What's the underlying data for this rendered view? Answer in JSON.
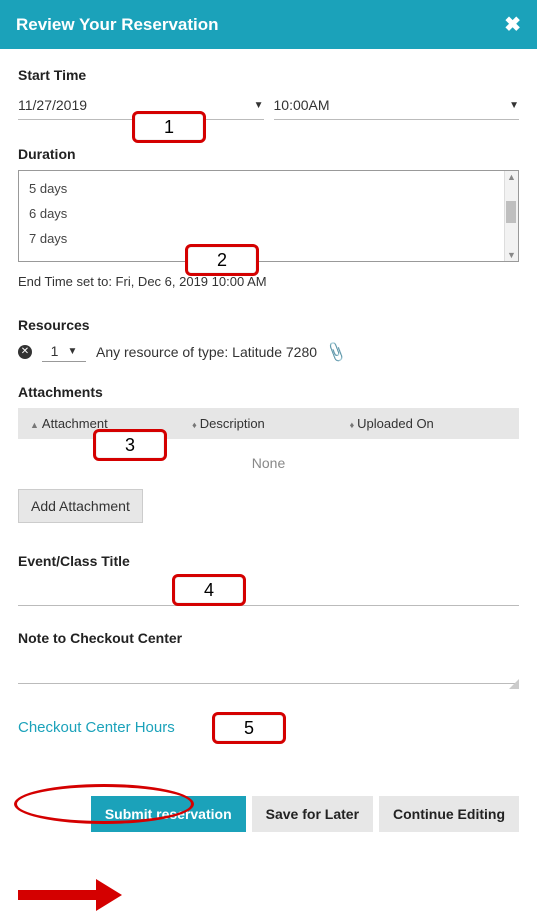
{
  "header": {
    "title": "Review Your Reservation"
  },
  "start": {
    "label": "Start Time",
    "date_value": "11/27/2019",
    "time_value": "10:00AM"
  },
  "duration": {
    "label": "Duration",
    "options": [
      "5 days",
      "6 days",
      "7 days"
    ]
  },
  "end_time_text": "End Time set to: Fri, Dec 6, 2019 10:00 AM",
  "resources": {
    "label": "Resources",
    "qty": "1",
    "line_text": "Any resource of type: Latitude 7280"
  },
  "attachments": {
    "label": "Attachments",
    "col_attachment": "Attachment",
    "col_description": "Description",
    "col_uploaded": "Uploaded On",
    "empty_text": "None",
    "add_button": "Add Attachment"
  },
  "event_title": {
    "label": "Event/Class Title",
    "value": ""
  },
  "note": {
    "label": "Note to Checkout Center",
    "value": ""
  },
  "link_hours": "Checkout Center Hours",
  "buttons": {
    "submit": "Submit reservation",
    "save": "Save for Later",
    "continue": "Continue Editing"
  },
  "callouts": {
    "c1": "1",
    "c2": "2",
    "c3": "3",
    "c4": "4",
    "c5": "5"
  }
}
